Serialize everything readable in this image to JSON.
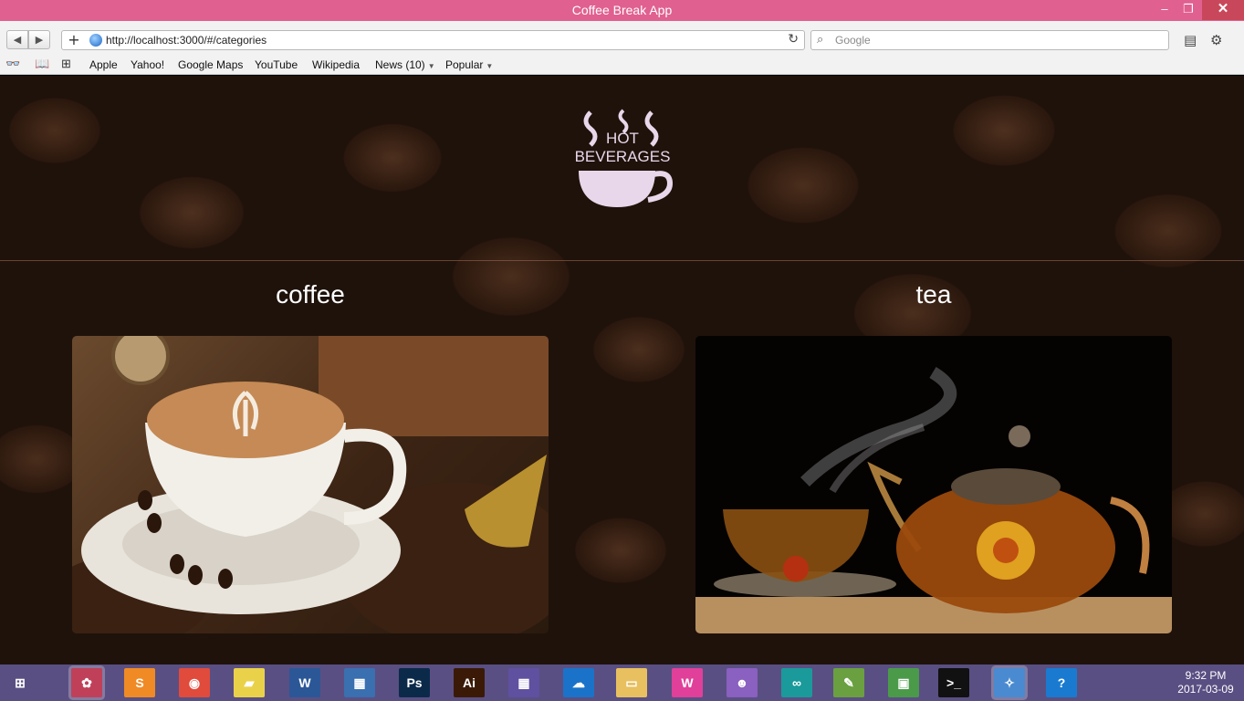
{
  "window": {
    "title": "Coffee Break App",
    "minimize_glyph": "–",
    "maximize_glyph": "❐",
    "close_glyph": "✕"
  },
  "toolbar": {
    "back_glyph": "◀",
    "forward_glyph": "▶",
    "new_tab_glyph": "+",
    "url": "http://localhost:3000/#/categories",
    "reload_glyph": "↻",
    "search_placeholder": "Google",
    "page_menu_glyph": "▤",
    "tools_menu_glyph": "⚙"
  },
  "bookmarks": {
    "reader_glyph": "👓",
    "bookmarks_glyph": "📖",
    "grid_glyph": "⊞",
    "items": [
      {
        "label": "Apple"
      },
      {
        "label": "Yahoo!"
      },
      {
        "label": "Google Maps"
      },
      {
        "label": "YouTube"
      },
      {
        "label": "Wikipedia"
      },
      {
        "label": "News (10)",
        "dropdown": true
      },
      {
        "label": "Popular",
        "dropdown": true
      }
    ],
    "dropdown_glyph": "▼"
  },
  "page": {
    "logo": {
      "line1": "HOT",
      "line2": "BEVERAGES",
      "color": "#e8d6ea"
    },
    "categories": [
      {
        "title": "coffee",
        "image_icon": "coffee-cup-image"
      },
      {
        "title": "tea",
        "image_icon": "teapot-image"
      }
    ]
  },
  "taskbar": {
    "time": "9:32 PM",
    "date": "2017-03-09",
    "apps": [
      {
        "name": "start",
        "glyph": "⊞",
        "color": "#ffffff"
      },
      {
        "name": "paint",
        "glyph": "✿",
        "color": "#c0405a"
      },
      {
        "name": "sublime",
        "glyph": "S",
        "color": "#f08a24"
      },
      {
        "name": "chrome",
        "glyph": "◉",
        "color": "#e04b3c"
      },
      {
        "name": "notes",
        "glyph": "▰",
        "color": "#e9d24a"
      },
      {
        "name": "word",
        "glyph": "W",
        "color": "#2b5797"
      },
      {
        "name": "calculator",
        "glyph": "▦",
        "color": "#3a6fb0"
      },
      {
        "name": "photoshop",
        "glyph": "Ps",
        "color": "#0b2a4a"
      },
      {
        "name": "illustrator",
        "glyph": "Ai",
        "color": "#3a1a06"
      },
      {
        "name": "calendar",
        "glyph": "▦",
        "color": "#6050a0"
      },
      {
        "name": "onedrive",
        "glyph": "☁",
        "color": "#1a73c8"
      },
      {
        "name": "explorer",
        "glyph": "▭",
        "color": "#e8c060"
      },
      {
        "name": "wamp",
        "glyph": "W",
        "color": "#e0409a"
      },
      {
        "name": "cat",
        "glyph": "☻",
        "color": "#8a60c0"
      },
      {
        "name": "arduino",
        "glyph": "∞",
        "color": "#1a9a9a"
      },
      {
        "name": "notepad",
        "glyph": "✎",
        "color": "#6aa040"
      },
      {
        "name": "manager",
        "glyph": "▣",
        "color": "#4a9a4a"
      },
      {
        "name": "terminal",
        "glyph": ">_",
        "color": "#111111"
      },
      {
        "name": "safari",
        "glyph": "✧",
        "color": "#4a8ad0"
      },
      {
        "name": "help",
        "glyph": "?",
        "color": "#1a7ad0"
      }
    ]
  }
}
